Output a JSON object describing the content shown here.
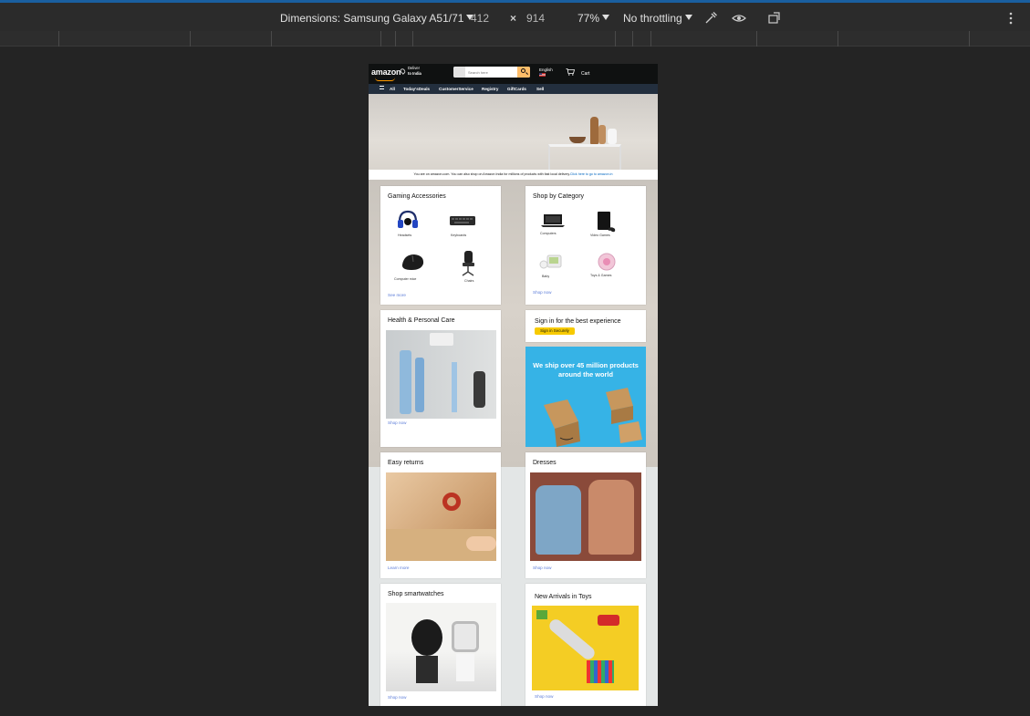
{
  "devtools": {
    "dimensions_label": "Dimensions: Samsung Galaxy A51/71",
    "width": "412",
    "times": "×",
    "height": "914",
    "zoom": "77%",
    "throttling": "No throttling"
  },
  "nav": {
    "logo": "amazon",
    "deliver_line1": "Deliver",
    "deliver_line2": "to India",
    "search_placeholder": "Search here",
    "language": "English",
    "cart_label": "Cart"
  },
  "subnav": {
    "items": [
      "All",
      "Today'sDeals",
      "CustomerService",
      "Registry",
      "GiftCards",
      "Sell"
    ]
  },
  "notice": {
    "text": "You are on amazon.com. You can also shop on Amazon India for millions of products with fast local delivery.",
    "link": "Click here to go to amazon.in"
  },
  "cards": {
    "gaming": {
      "title": "Gaming Accessories",
      "tiles": [
        "Headsets",
        "Keyboards",
        "Computer mice",
        "Chairs"
      ],
      "more": "See more"
    },
    "category": {
      "title": "Shop by Category",
      "tiles": [
        "Computers",
        "Video Games",
        "Baby",
        "Toys & Games"
      ],
      "more": "Shop now"
    },
    "health": {
      "title": "Health & Personal Care",
      "more": "Shop now"
    },
    "signin": {
      "title": "Sign in for the best experience",
      "button": "Sign in Securely"
    },
    "ship": {
      "text": "We ship over 45 million products around the world"
    },
    "returns": {
      "title": "Easy returns",
      "more": "Learn more"
    },
    "dresses": {
      "title": "Dresses",
      "more": "Shop now"
    },
    "smartwatches": {
      "title": "Shop smartwatches",
      "more": "Shop now"
    },
    "toys": {
      "title": "New Arrivals in Toys",
      "more": "Shop now"
    }
  },
  "colors": {
    "nav_bg": "#0f1111",
    "subnav_bg": "#232f3e",
    "accent": "#febd69",
    "link": "#5a7bd8",
    "signin_button": "#f7ca00",
    "ship_bg": "#36b3e6"
  }
}
